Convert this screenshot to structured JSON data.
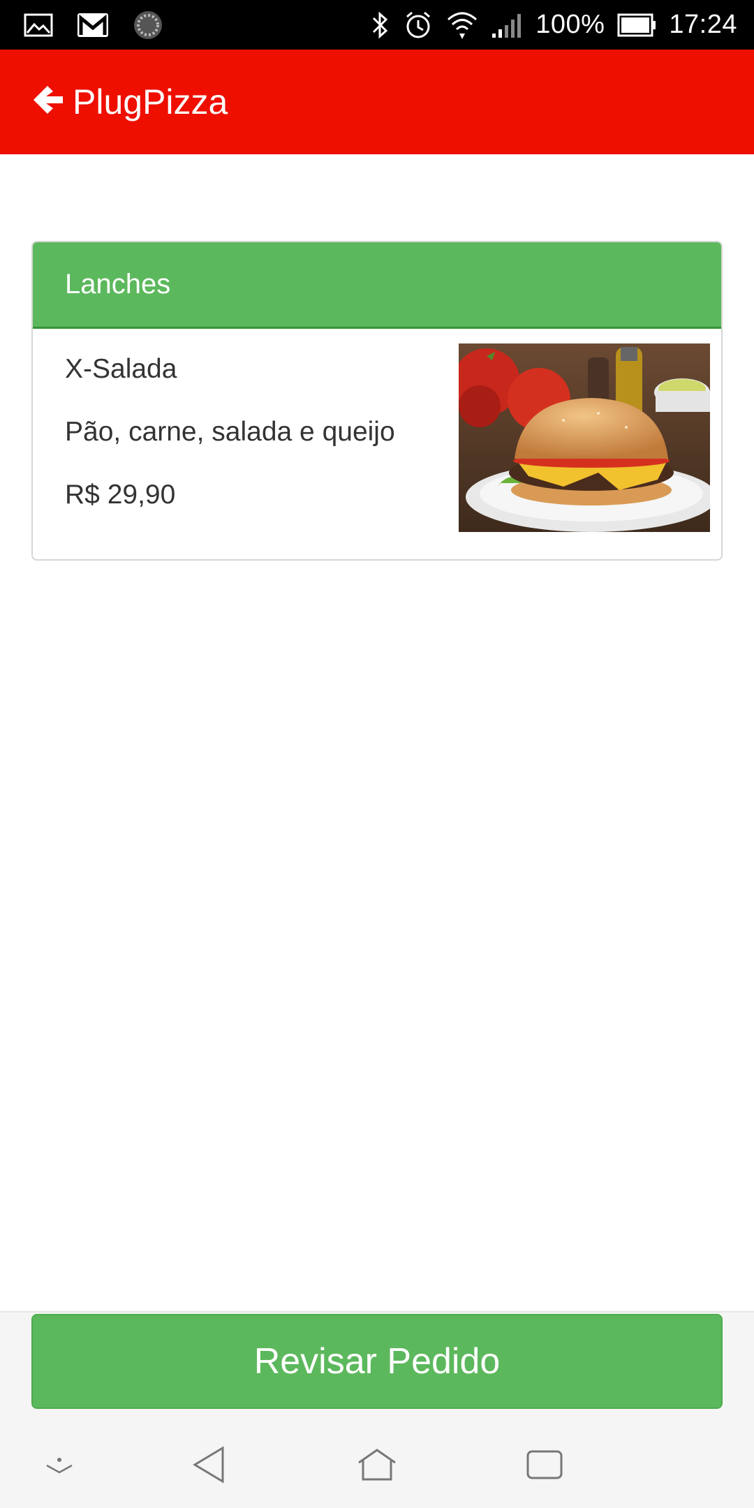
{
  "status_bar": {
    "battery_percent": "100%",
    "time": "17:24",
    "icons": [
      "gallery-icon",
      "gmail-icon",
      "sync-icon",
      "bluetooth-icon",
      "alarm-icon",
      "wifi-icon",
      "signal-icon",
      "battery-icon"
    ]
  },
  "app_bar": {
    "title": "PlugPizza",
    "background_color": "#ee0f00"
  },
  "category": {
    "header": "Lanches",
    "header_color": "#5cb85c",
    "items": [
      {
        "name": "X-Salada",
        "description": "Pão, carne, salada e queijo",
        "price": "R$ 29,90",
        "image": "burger-photo"
      }
    ]
  },
  "review_button": {
    "label": "Revisar Pedido",
    "color": "#5cb85c"
  },
  "nav_bar": {
    "icons": [
      "hide-nav-icon",
      "back-icon",
      "home-icon",
      "recents-icon"
    ]
  }
}
